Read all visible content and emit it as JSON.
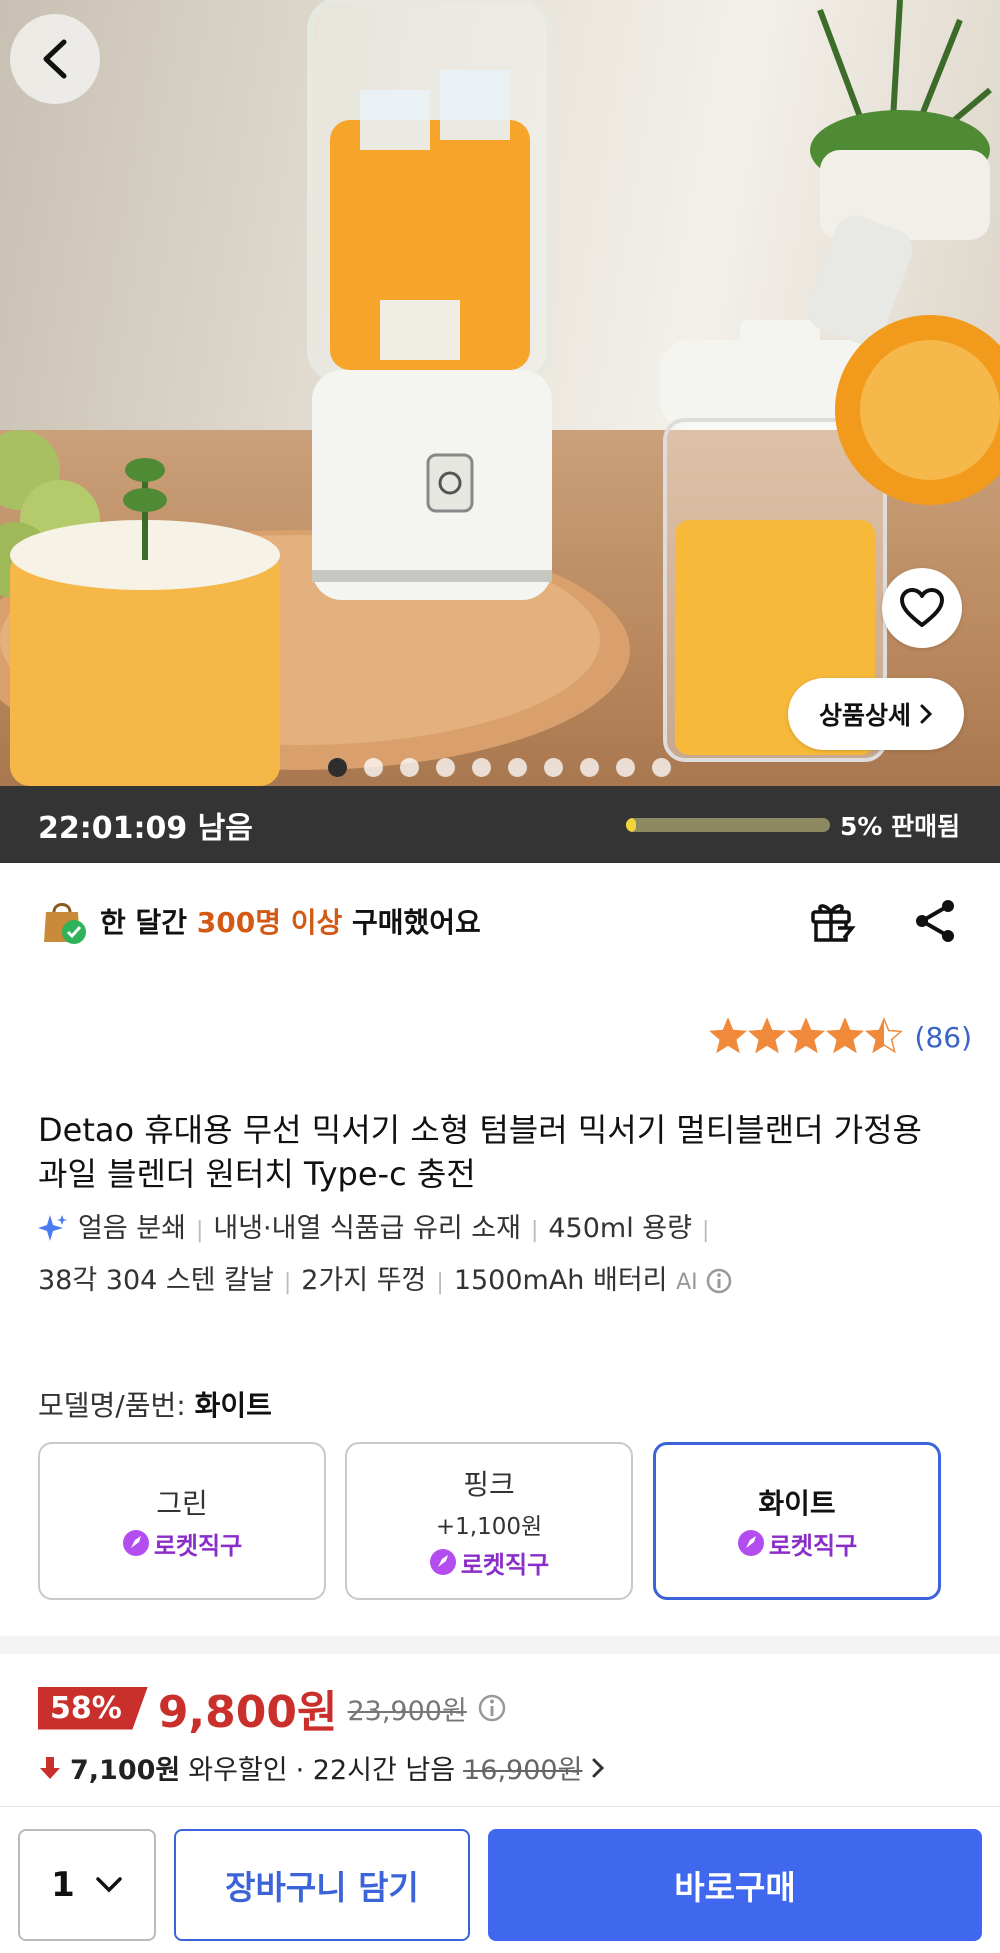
{
  "hero": {
    "detail_label": "상품상세",
    "dots_total": 10,
    "dots_active_index": 0
  },
  "deal": {
    "timer": "22:01:09 남음",
    "sold_percent": 5,
    "sold_label": "5% 판매됨"
  },
  "social_proof": {
    "prefix": "한 달간",
    "highlight": "300명 이상",
    "suffix": "구매했어요"
  },
  "rating": {
    "stars": 4.5,
    "count": "(86)"
  },
  "product": {
    "title": "Detao 휴대용 무선 믹서기 소형 텀블러 믹서기 멀티블랜더 가정용 과일 블렌더 원터치 Type-c 충전",
    "features": [
      "얼음 분쇄",
      "내냉·내열 식품급 유리 소재",
      "450ml 용량",
      "38각 304 스텐 칼날",
      "2가지 뚜껑",
      "1500mAh 배터리"
    ],
    "ai_label": "AI"
  },
  "model": {
    "label": "모델명/품번:",
    "selected": "화이트",
    "options": [
      {
        "name": "그린",
        "price": "",
        "badge": "로켓직구"
      },
      {
        "name": "핑크",
        "price": "+1,100원",
        "badge": "로켓직구"
      },
      {
        "name": "화이트",
        "price": "",
        "badge": "로켓직구"
      }
    ]
  },
  "pricing": {
    "discount": "58%",
    "price": "9,800원",
    "original": "23,900원",
    "wow_amount": "7,100원",
    "wow_label": "와우할인",
    "wow_time": "· 22시간 남음",
    "wow_original": "16,900원"
  },
  "bottom_bar": {
    "qty": "1",
    "cart_label": "장바구니 담기",
    "buy_label": "바로구매"
  },
  "colors": {
    "accent": "#3f68ef",
    "sale_red": "#c9302c",
    "rocket_purple": "#8a2dc9",
    "star_orange": "#f08a3a",
    "highlight_orange": "#d35a14"
  }
}
